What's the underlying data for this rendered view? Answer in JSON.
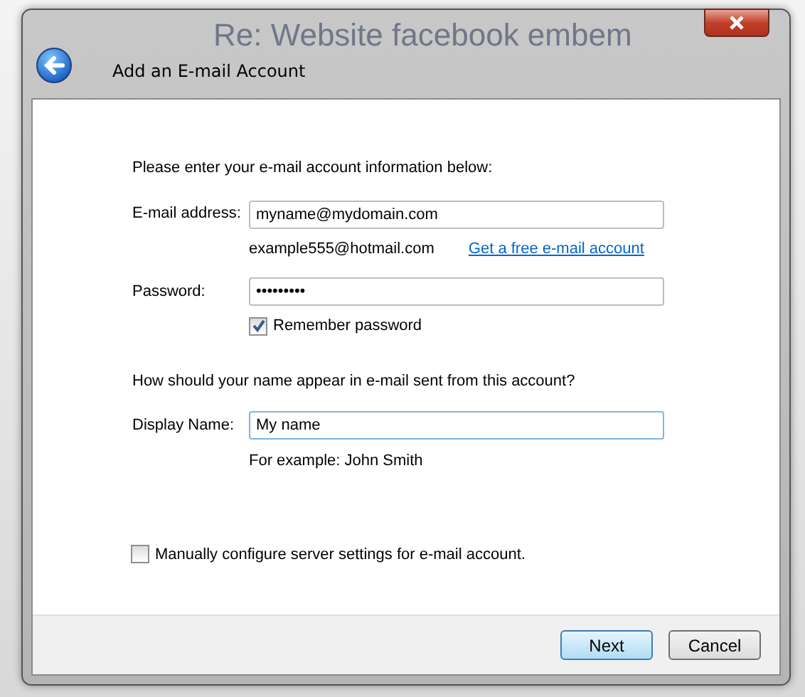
{
  "background": {
    "window_title": "Re: Website facebook embem"
  },
  "window": {
    "title": "Add an E-mail Account"
  },
  "intro": "Please enter your e-mail account information below:",
  "email": {
    "label": "E-mail address:",
    "value": "myname@mydomain.com",
    "example": "example555@hotmail.com",
    "link": "Get a free e-mail account"
  },
  "password": {
    "label": "Password:",
    "value": "•••••••••"
  },
  "remember": {
    "label": "Remember password",
    "checked": true
  },
  "name_question": "How should your name appear in e-mail sent from this account?",
  "display_name": {
    "label": "Display Name:",
    "value": "My name",
    "focused": true,
    "example": "For example: John Smith"
  },
  "manual": {
    "label": "Manually configure server settings for e-mail account.",
    "checked": false
  },
  "buttons": [
    {
      "label": "Next",
      "default": true
    },
    {
      "label": "Cancel",
      "default": false
    }
  ]
}
